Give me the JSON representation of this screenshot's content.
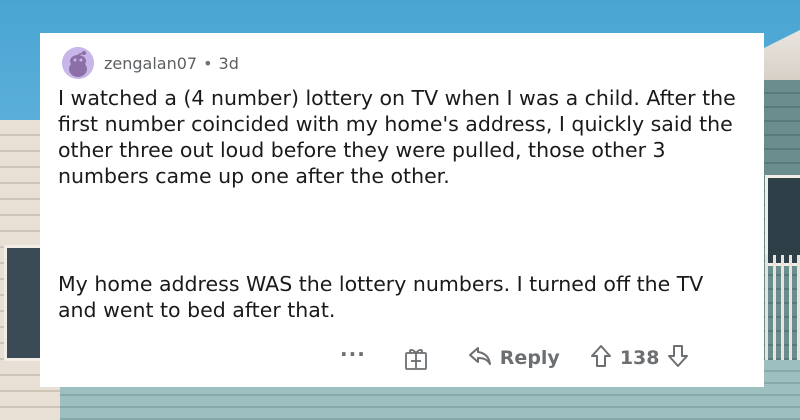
{
  "comment": {
    "username": "zengalan07",
    "separator": "•",
    "age": "3d",
    "paragraphs": [
      "I watched a (4 number) lottery on TV when I was a child. After the first number coincided with my home's address, I quickly said the other three out loud before they were pulled, those other 3 numbers came up one after the other.",
      "My home address WAS the lottery numbers. I turned off the TV and went to bed after that."
    ],
    "actions": {
      "more": "···",
      "reply_label": "Reply",
      "vote_count": "138"
    }
  },
  "icons": {
    "avatar": "snoo-avatar-icon",
    "award": "gift-box-icon",
    "reply": "reply-arrow-icon",
    "upvote": "upvote-arrow-icon",
    "downvote": "downvote-arrow-icon"
  },
  "colors": {
    "card_background": "#ffffff",
    "body_text": "#1a1a1b",
    "meta_text": "#5d6063",
    "avatar_background": "#c9b6e8"
  }
}
